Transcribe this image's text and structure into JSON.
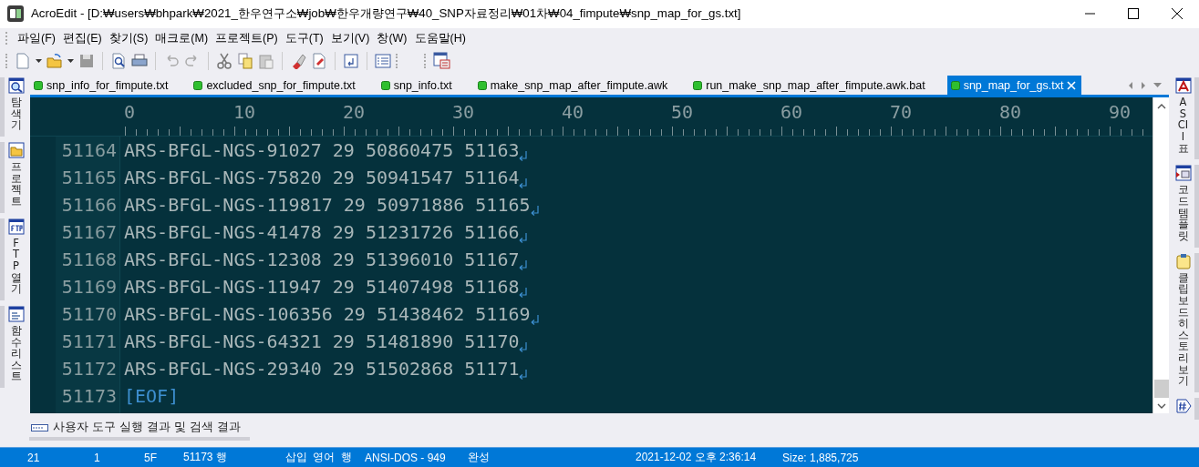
{
  "window": {
    "title": "AcroEdit - [D:₩users₩bhpark₩2021_한우연구소₩job₩한우개량연구₩40_SNP자료정리₩01차₩04_fimpute₩snp_map_for_gs.txt]"
  },
  "menu": [
    "파일(F)",
    "편집(E)",
    "찾기(S)",
    "매크로(M)",
    "프로젝트(P)",
    "도구(T)",
    "보기(V)",
    "창(W)",
    "도움말(H)"
  ],
  "tabs": [
    {
      "label": "snp_info_for_fimpute.txt",
      "selected": false
    },
    {
      "label": "excluded_snp_for_fimpute.txt",
      "selected": false
    },
    {
      "label": "snp_info.txt",
      "selected": false
    },
    {
      "label": "make_snp_map_after_fimpute.awk",
      "selected": false
    },
    {
      "label": "run_make_snp_map_after_fimpute.awk.bat",
      "selected": false
    },
    {
      "label": "snp_map_for_gs.txt",
      "selected": true
    }
  ],
  "ruler": [
    "0",
    "10",
    "20",
    "30",
    "40",
    "50",
    "60",
    "70",
    "80",
    "90"
  ],
  "lines": [
    {
      "number": "51164",
      "text": "ARS-BFGL-NGS-91027 29 50860475 51163",
      "kind": "text"
    },
    {
      "number": "51165",
      "text": "ARS-BFGL-NGS-75820 29 50941547 51164",
      "kind": "text"
    },
    {
      "number": "51166",
      "text": "ARS-BFGL-NGS-119817 29 50971886 51165",
      "kind": "text"
    },
    {
      "number": "51167",
      "text": "ARS-BFGL-NGS-41478 29 51231726 51166",
      "kind": "text"
    },
    {
      "number": "51168",
      "text": "ARS-BFGL-NGS-12308 29 51396010 51167",
      "kind": "text"
    },
    {
      "number": "51169",
      "text": "ARS-BFGL-NGS-11947 29 51407498 51168",
      "kind": "text"
    },
    {
      "number": "51170",
      "text": "ARS-BFGL-NGS-106356 29 51438462 51169",
      "kind": "text"
    },
    {
      "number": "51171",
      "text": "ARS-BFGL-NGS-64321 29 51481890 51170",
      "kind": "text"
    },
    {
      "number": "51172",
      "text": "ARS-BFGL-NGS-29340 29 51502868 51171",
      "kind": "text"
    },
    {
      "number": "51173",
      "text": "[EOF]",
      "kind": "eof"
    }
  ],
  "left_panel": [
    {
      "label": "탐색기",
      "kind": "labeled"
    },
    {
      "label": "프로젝트",
      "kind": "labeled"
    },
    {
      "label": "FTP 열기",
      "kind": "labeled"
    },
    {
      "label": "함수 리스트",
      "kind": "labeled"
    }
  ],
  "right_panel": [
    {
      "label": "ASCII 표",
      "kind": "labeled"
    },
    {
      "label": "코드 템플릿",
      "kind": "labeled"
    },
    {
      "label": "클립보드 히스토리 보기",
      "kind": "labeled"
    },
    {
      "kind": "icon_only"
    }
  ],
  "output_panel": {
    "label": "사용자 도구 실행 결과 및 검색 결과"
  },
  "status_bar": [
    "21",
    "1",
    "5F",
    "51173 행",
    "삽입",
    "영어",
    "행",
    "ANSI-DOS - 949",
    "완성",
    "2021-12-02 오후 2:36:14",
    "Size: 1,885,725"
  ]
}
